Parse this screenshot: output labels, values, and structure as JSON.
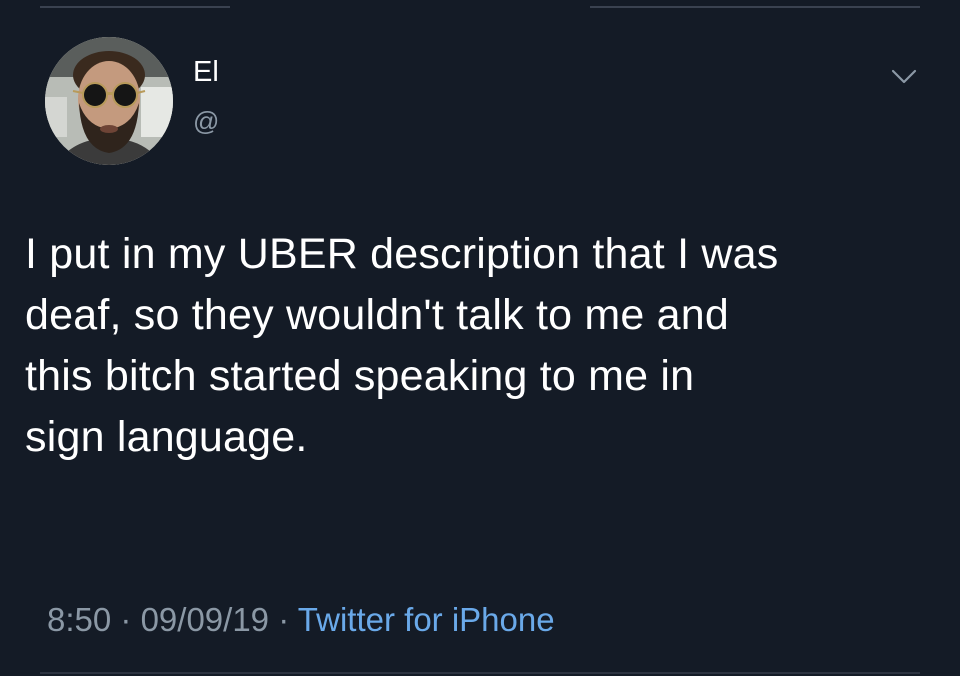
{
  "tweet": {
    "author": {
      "display_name": "El",
      "handle": "@"
    },
    "text_lines": [
      "I put in my UBER description that I was",
      "deaf, so they wouldn't talk to me and",
      "this bitch started speaking to me in",
      "sign language."
    ],
    "time": "8:50",
    "separator": "·",
    "date": "09/09/19",
    "source": "Twitter for iPhone"
  },
  "icons": {
    "menu": "chevron-down-icon",
    "avatar": "profile-photo"
  },
  "colors": {
    "background": "#141b26",
    "text": "#ffffff",
    "muted": "#8b98a5",
    "link": "#6aa9e9"
  }
}
